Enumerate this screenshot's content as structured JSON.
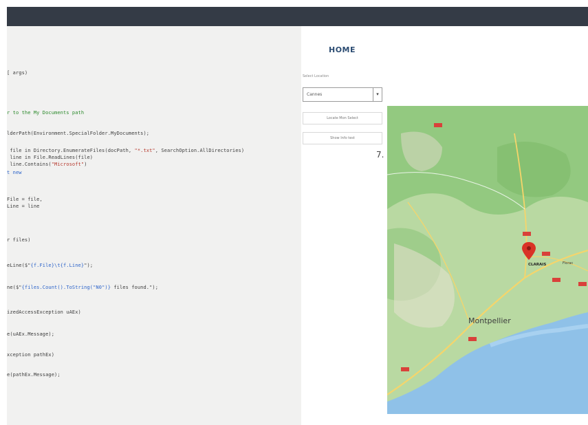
{
  "code_lines": [
    {
      "segments": [
        {
          "t": "[ args)",
          "c": ""
        }
      ]
    },
    {
      "segments": [
        {
          "t": "r to the My Documents path",
          "c": "cm"
        }
      ]
    },
    {
      "segments": [
        {
          "t": "lderPath(Environment.SpecialFolder.MyDocuments);",
          "c": ""
        }
      ]
    },
    {
      "segments": [
        {
          "t": " file in Directory.EnumerateFiles(docPath, ",
          "c": ""
        },
        {
          "t": "\"*.txt\"",
          "c": "str"
        },
        {
          "t": ", SearchOption.AllDirectories)",
          "c": ""
        }
      ]
    },
    {
      "segments": [
        {
          "t": " line in File.ReadLines(file)",
          "c": ""
        }
      ]
    },
    {
      "segments": [
        {
          "t": " line.Contains(",
          "c": ""
        },
        {
          "t": "\"Microsoft\"",
          "c": "str"
        },
        {
          "t": ")",
          "c": ""
        }
      ]
    },
    {
      "segments": [
        {
          "t": "t new",
          "c": "kw"
        }
      ]
    },
    {
      "segments": [
        {
          "t": "File = file,",
          "c": ""
        }
      ]
    },
    {
      "segments": [
        {
          "t": "Line = line",
          "c": ""
        }
      ]
    },
    {
      "segments": [
        {
          "t": "r files)",
          "c": ""
        }
      ]
    },
    {
      "segments": [
        {
          "t": "eLine($\"",
          "c": ""
        },
        {
          "t": "{f.File}\\t{f.Line}",
          "c": "kw"
        },
        {
          "t": "\");",
          "c": ""
        }
      ]
    },
    {
      "segments": [
        {
          "t": "ne($\"",
          "c": ""
        },
        {
          "t": "{files.Count().ToString(\"N0\")}",
          "c": "kw"
        },
        {
          "t": " files found.\");",
          "c": ""
        }
      ]
    },
    {
      "segments": [
        {
          "t": "izedAccessException uAEx)",
          "c": ""
        }
      ]
    },
    {
      "segments": [
        {
          "t": "e(uAEx.Message);",
          "c": ""
        }
      ]
    },
    {
      "segments": [
        {
          "t": "xception pathEx)",
          "c": ""
        }
      ]
    },
    {
      "segments": [
        {
          "t": "e(pathEx.Message);",
          "c": ""
        }
      ]
    }
  ],
  "right_panel": {
    "title": "HOME",
    "select_label": "Select Location",
    "select_value": "Cannes",
    "button1_label": "Locate Mon Select",
    "button2_label": "Show Info test",
    "step_number": "7."
  },
  "map": {
    "city_label_main": "Montpellier",
    "marker_label": "CLARAIS",
    "town_label_1": "Florac",
    "colors": {
      "land": "#b9d9a2",
      "forest": "#8fc67c",
      "sea": "#8fc1e8",
      "road": "#f6d56b",
      "marker": "#d93326",
      "urban": "#e9e1d3"
    }
  }
}
